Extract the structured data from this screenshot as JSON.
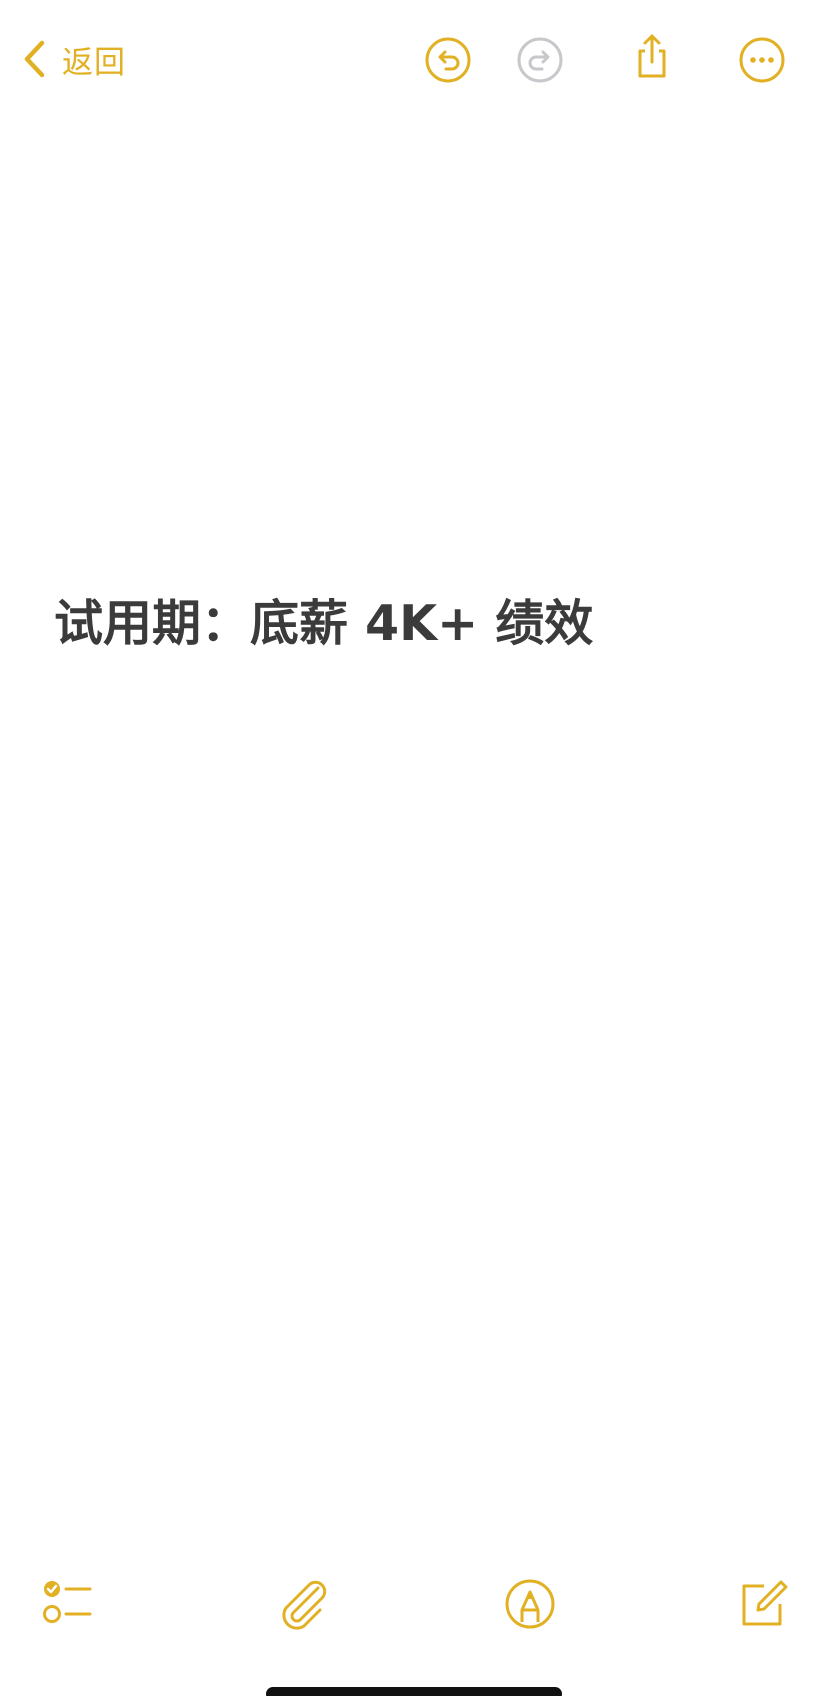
{
  "nav": {
    "back_label": "返回"
  },
  "note": {
    "lines": [
      "试用期：底薪 4K+ 绩效"
    ]
  },
  "icons": {
    "back": "chevron-left-icon",
    "undo": "undo-icon",
    "redo": "redo-icon",
    "share": "share-icon",
    "more": "ellipsis-circle-icon",
    "checklist": "checklist-icon",
    "attach": "paperclip-icon",
    "markup": "markup-pen-icon",
    "compose": "compose-icon"
  },
  "colors": {
    "accent": "#E2B023",
    "disabled": "#C7C7CC",
    "text": "#3B3B3B",
    "background": "#FFFFFF"
  },
  "state": {
    "redo_enabled": false
  }
}
